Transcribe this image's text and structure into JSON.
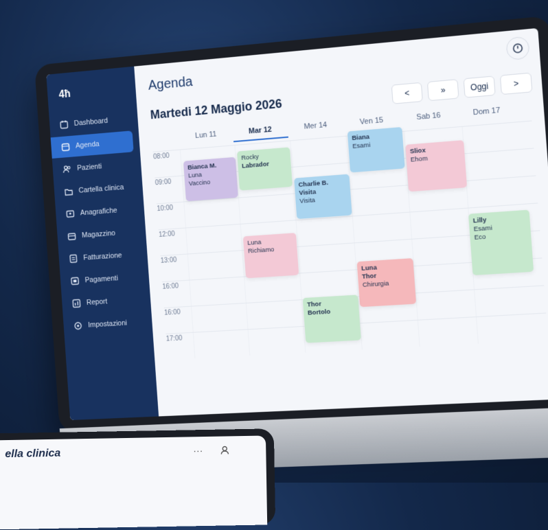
{
  "sidebar": {
    "logo": "4ħ",
    "items": [
      {
        "label": "Dashboard",
        "icon": "calendar-icon"
      },
      {
        "label": "Agenda",
        "icon": "calendar-icon",
        "active": true
      },
      {
        "label": "Pazienti",
        "icon": "users-icon"
      },
      {
        "label": "Cartella clinica",
        "icon": "folder-icon"
      },
      {
        "label": "Anagrafiche",
        "icon": "id-card-icon"
      },
      {
        "label": "Magazzino",
        "icon": "box-icon"
      },
      {
        "label": "Fatturazione",
        "icon": "invoice-icon"
      },
      {
        "label": "Pagamenti",
        "icon": "card-icon"
      },
      {
        "label": "Report",
        "icon": "chart-icon"
      },
      {
        "label": "Impostazioni",
        "icon": "gear-icon"
      }
    ]
  },
  "header": {
    "title": "Agenda",
    "date": "Martedi 12 Maggio 2026"
  },
  "controls": {
    "prev": "<",
    "double_next": "»",
    "today": "Oggi",
    "next": ">"
  },
  "days": [
    "Lun 11",
    "Mar 12",
    "Mer 14",
    "Ven 15",
    "Sab 16",
    "Dom 17"
  ],
  "times": [
    "08:00",
    "09:00",
    "10:00",
    "12:00",
    "13:00",
    "16:00",
    "16:00",
    "17:00"
  ],
  "events": [
    {
      "name": "Bianca M.",
      "l1": "Luna",
      "l2": "Vaccino",
      "color": "#cdbfe6"
    },
    {
      "name": "Rocky",
      "l1": "Labrador",
      "l2": "",
      "color": "#c6e8cd"
    },
    {
      "name": "Charlie B.",
      "l1": "Visita",
      "l2": "Visita",
      "color": "#a9d4ef"
    },
    {
      "name": "Biana",
      "l1": "Esami",
      "l2": "",
      "color": "#a9d4ef"
    },
    {
      "name": "Sliox",
      "l1": "Ehom",
      "l2": "",
      "color": "#f3c9d6"
    },
    {
      "name": "Luna",
      "l1": "Richiamo",
      "l2": "",
      "color": "#f3c9d6"
    },
    {
      "name": "Lilly",
      "l1": "Esami",
      "l2": "Eco",
      "color": "#c6e8cd"
    },
    {
      "name": "Luna",
      "l1": "Thor",
      "l2": "Chirurgia",
      "color": "#f5b8bb"
    },
    {
      "name": "Thor",
      "l1": "Bortolo",
      "l2": "",
      "color": "#c6e8cd"
    }
  ],
  "tablet": {
    "title": "ella clinica",
    "more": "···"
  }
}
